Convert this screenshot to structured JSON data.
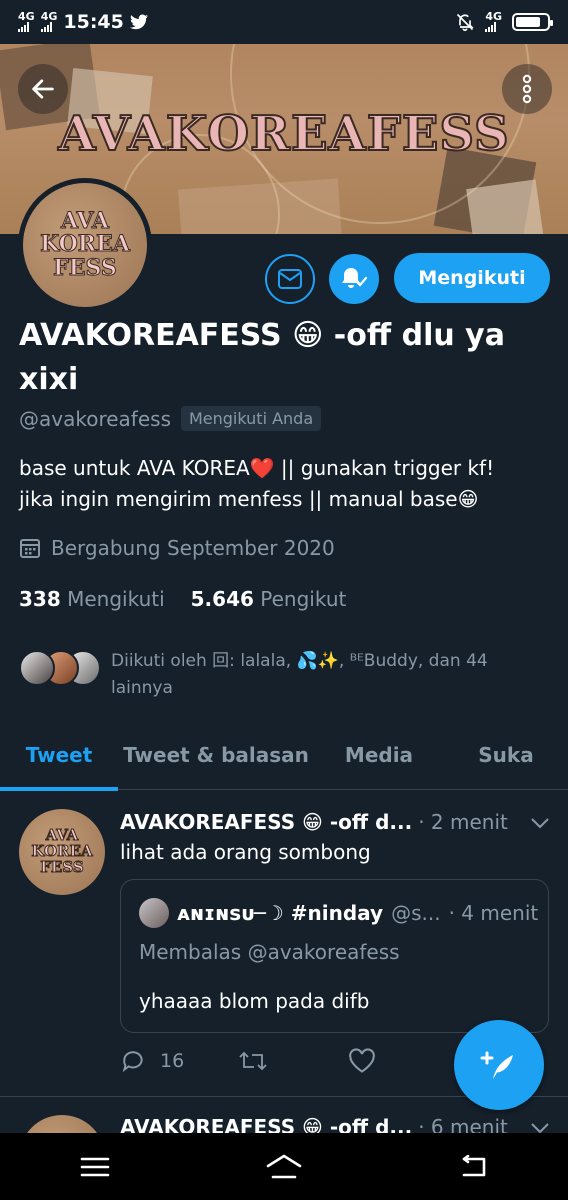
{
  "status_bar": {
    "network1": "4G",
    "network2": "4G",
    "time": "15:45",
    "network3": "4G",
    "battery_level": 0.8,
    "icons": [
      "twitter-icon",
      "mute-icon",
      "battery-icon"
    ]
  },
  "banner": {
    "title": "AVAKOREAFESS"
  },
  "avatar": {
    "line1": "AVA",
    "line2": "KOREA",
    "line3": "FESS"
  },
  "actions": {
    "follow_label": "Mengikuti"
  },
  "profile": {
    "name": "AVAKOREAFESS 😁 -off dlu ya xixi",
    "handle": "@avakoreafess",
    "follows_you": "Mengikuti Anda",
    "bio_line1": "base untuk AVA KOREA❤️ || gunakan trigger kf!",
    "bio_line2": "jika ingin mengirim menfess || manual base😁",
    "joined": "Bergabung September 2020",
    "following_count": "338",
    "following_label": "Mengikuti",
    "followers_count": "5.646",
    "followers_label": "Pengikut",
    "followed_by_line1": "Diikuti oleh 回: lalala, 💦✨, ᴮᴱBuddy, dan 44",
    "followed_by_line2": "lainnya"
  },
  "tabs": [
    {
      "label": "Tweet"
    },
    {
      "label": "Tweet & balasan"
    },
    {
      "label": "Media"
    },
    {
      "label": "Suka"
    }
  ],
  "tweet": {
    "name": "AVAKOREAFESS 😁 -off d...",
    "time": "· 2 menit",
    "text": "lihat ada orang sombong",
    "quote": {
      "name": "ᴀɴɪɴsᴜ─☽ #ninday",
      "handle": "@s...",
      "time": "· 4 menit",
      "reply_to": "Membalas @avakoreafess",
      "text": "yhaaaa blom pada difb"
    },
    "reply_count": "16"
  },
  "tweet2": {
    "name": "AVAKOREAFESS 😁 -off d...",
    "time": "· 6 menit"
  },
  "colors": {
    "background": "#15202b",
    "accent": "#1da1f2",
    "secondary_text": "#8899a6",
    "divider": "#38444d"
  }
}
